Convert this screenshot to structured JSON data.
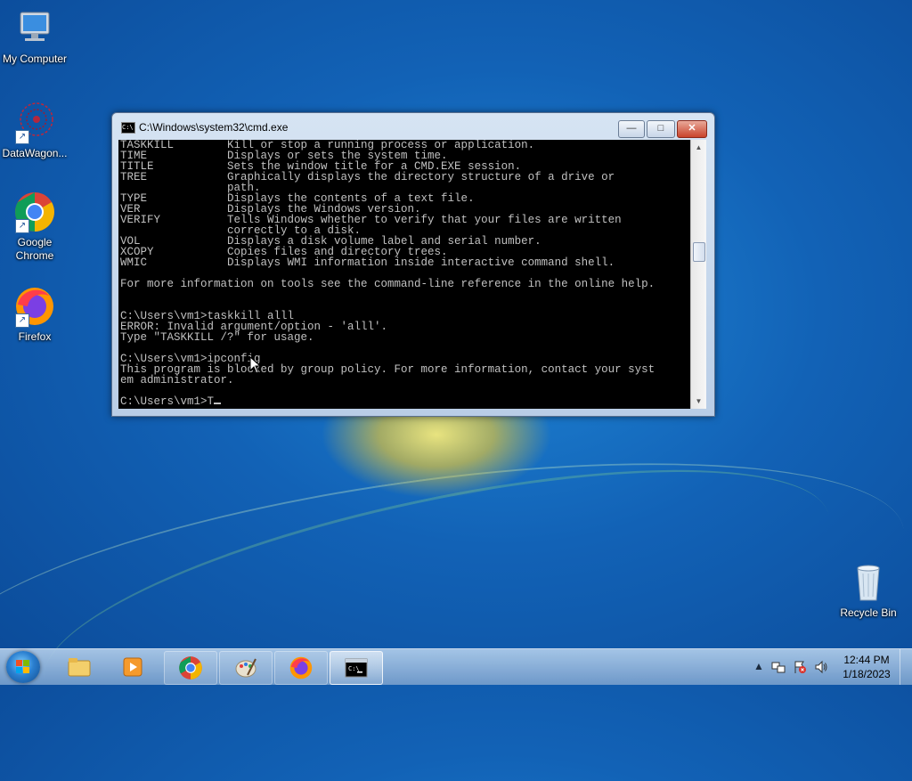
{
  "desktop": {
    "icons": [
      {
        "label": "My Computer"
      },
      {
        "label": "DataWagon..."
      },
      {
        "label": "Google Chrome"
      },
      {
        "label": "Firefox"
      },
      {
        "label": "Recycle Bin"
      }
    ]
  },
  "cmd_window": {
    "title": "C:\\Windows\\system32\\cmd.exe",
    "lines": [
      "TASKKILL        Kill or stop a running process or application.",
      "TIME            Displays or sets the system time.",
      "TITLE           Sets the window title for a CMD.EXE session.",
      "TREE            Graphically displays the directory structure of a drive or",
      "                path.",
      "TYPE            Displays the contents of a text file.",
      "VER             Displays the Windows version.",
      "VERIFY          Tells Windows whether to verify that your files are written",
      "                correctly to a disk.",
      "VOL             Displays a disk volume label and serial number.",
      "XCOPY           Copies files and directory trees.",
      "WMIC            Displays WMI information inside interactive command shell.",
      "",
      "For more information on tools see the command-line reference in the online help.",
      "",
      "",
      "C:\\Users\\vm1>taskkill alll",
      "ERROR: Invalid argument/option - 'alll'.",
      "Type \"TASKKILL /?\" for usage.",
      "",
      "C:\\Users\\vm1>ipconfig",
      "This program is blocked by group policy. For more information, contact your syst",
      "em administrator.",
      "",
      "C:\\Users\\vm1>T"
    ],
    "buttons": {
      "minimize": "—",
      "maximize": "□",
      "close": "✕"
    }
  },
  "taskbar": {
    "pinned": [
      {
        "icon": "explorer-folder-icon"
      },
      {
        "icon": "media-player-icon"
      },
      {
        "icon": "chrome-icon"
      },
      {
        "icon": "paint-icon"
      },
      {
        "icon": "firefox-icon"
      },
      {
        "icon": "cmd-icon"
      }
    ],
    "clock": {
      "time": "12:44 PM",
      "date": "1/18/2023"
    }
  }
}
